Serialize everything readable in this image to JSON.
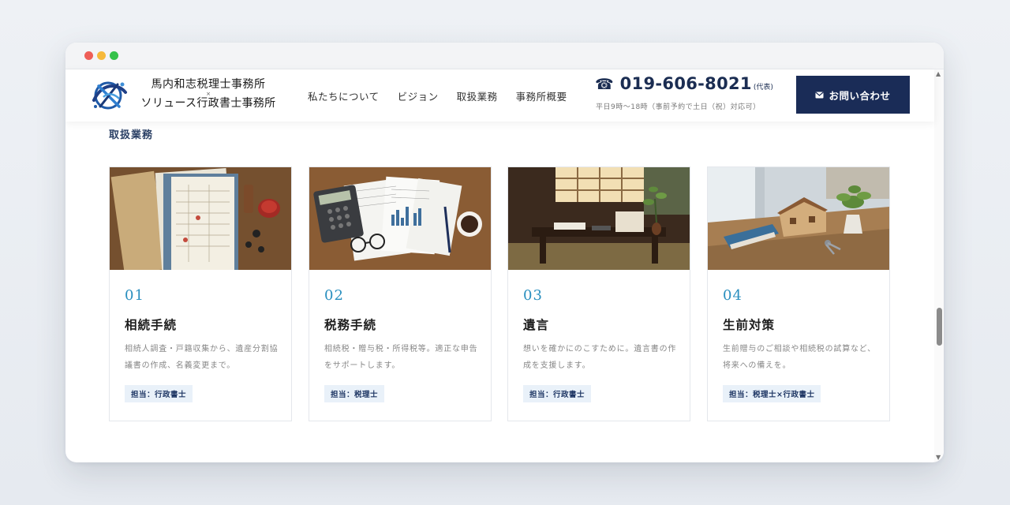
{
  "header": {
    "logo_line1": "馬内和志税理士事務所",
    "logo_separator": "×",
    "logo_line2": "ソリュース行政書士事務所",
    "nav": [
      {
        "label": "私たちについて"
      },
      {
        "label": "ビジョン"
      },
      {
        "label": "取扱業務"
      },
      {
        "label": "事務所概要"
      }
    ],
    "phone": {
      "icon": "phone-icon",
      "number": "019-606-8021",
      "note": "(代表)",
      "hours": "平日9時〜18時（事前予約で土日（祝）対応可）"
    },
    "cta": {
      "icon": "mail-icon",
      "label": "お問い合わせ"
    }
  },
  "section": {
    "title": "取扱業務"
  },
  "cards": [
    {
      "number": "01",
      "title": "相続手続",
      "desc": "相続人調査・戸籍収集から、遺産分割協議書の作成、名義変更まで。",
      "tag": "担当：行政書士"
    },
    {
      "number": "02",
      "title": "税務手続",
      "desc": "相続税・贈与税・所得税等。適正な申告をサポートします。",
      "tag": "担当：税理士"
    },
    {
      "number": "03",
      "title": "遺言",
      "desc": "想いを確かにのこすために。遺言書の作成を支援します。",
      "tag": "担当：行政書士"
    },
    {
      "number": "04",
      "title": "生前対策",
      "desc": "生前贈与のご相談や相続税の試算など、将来への備えを。",
      "tag": "担当：税理士×行政書士"
    }
  ],
  "colors": {
    "navy": "#1a2c57",
    "accent_blue": "#2a8fbf",
    "tag_bg": "#e9f1f9"
  }
}
